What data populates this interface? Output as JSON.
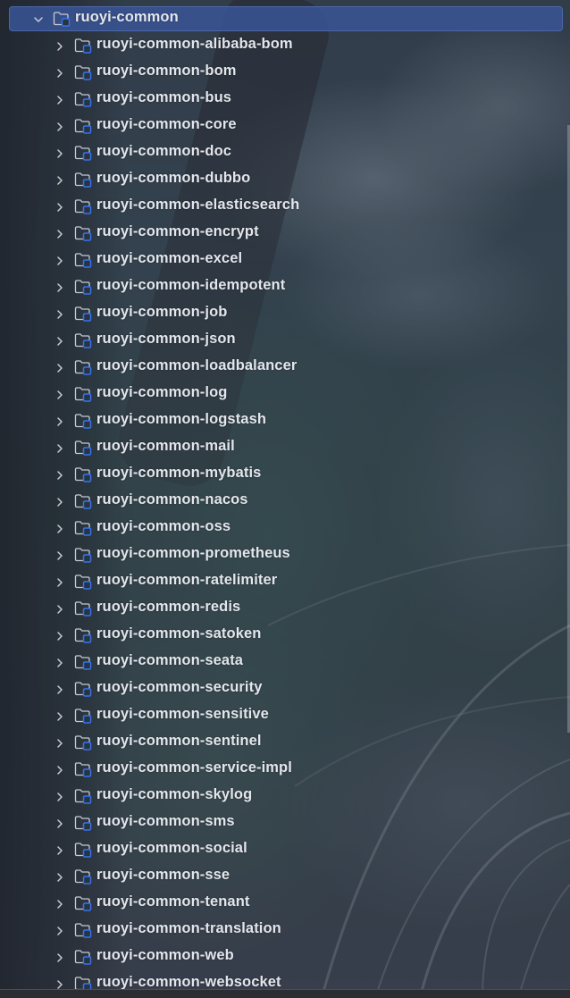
{
  "tree": {
    "root": {
      "label": "ruoyi-common",
      "expanded": true,
      "selected": true,
      "icon": "module-folder-icon"
    },
    "children": [
      {
        "label": "ruoyi-common-alibaba-bom",
        "expanded": false
      },
      {
        "label": "ruoyi-common-bom",
        "expanded": false
      },
      {
        "label": "ruoyi-common-bus",
        "expanded": false
      },
      {
        "label": "ruoyi-common-core",
        "expanded": false
      },
      {
        "label": "ruoyi-common-doc",
        "expanded": false
      },
      {
        "label": "ruoyi-common-dubbo",
        "expanded": false
      },
      {
        "label": "ruoyi-common-elasticsearch",
        "expanded": false
      },
      {
        "label": "ruoyi-common-encrypt",
        "expanded": false
      },
      {
        "label": "ruoyi-common-excel",
        "expanded": false
      },
      {
        "label": "ruoyi-common-idempotent",
        "expanded": false
      },
      {
        "label": "ruoyi-common-job",
        "expanded": false
      },
      {
        "label": "ruoyi-common-json",
        "expanded": false
      },
      {
        "label": "ruoyi-common-loadbalancer",
        "expanded": false
      },
      {
        "label": "ruoyi-common-log",
        "expanded": false
      },
      {
        "label": "ruoyi-common-logstash",
        "expanded": false
      },
      {
        "label": "ruoyi-common-mail",
        "expanded": false
      },
      {
        "label": "ruoyi-common-mybatis",
        "expanded": false
      },
      {
        "label": "ruoyi-common-nacos",
        "expanded": false
      },
      {
        "label": "ruoyi-common-oss",
        "expanded": false
      },
      {
        "label": "ruoyi-common-prometheus",
        "expanded": false
      },
      {
        "label": "ruoyi-common-ratelimiter",
        "expanded": false
      },
      {
        "label": "ruoyi-common-redis",
        "expanded": false
      },
      {
        "label": "ruoyi-common-satoken",
        "expanded": false
      },
      {
        "label": "ruoyi-common-seata",
        "expanded": false
      },
      {
        "label": "ruoyi-common-security",
        "expanded": false
      },
      {
        "label": "ruoyi-common-sensitive",
        "expanded": false
      },
      {
        "label": "ruoyi-common-sentinel",
        "expanded": false
      },
      {
        "label": "ruoyi-common-service-impl",
        "expanded": false
      },
      {
        "label": "ruoyi-common-skylog",
        "expanded": false
      },
      {
        "label": "ruoyi-common-sms",
        "expanded": false
      },
      {
        "label": "ruoyi-common-social",
        "expanded": false
      },
      {
        "label": "ruoyi-common-sse",
        "expanded": false
      },
      {
        "label": "ruoyi-common-tenant",
        "expanded": false
      },
      {
        "label": "ruoyi-common-translation",
        "expanded": false
      },
      {
        "label": "ruoyi-common-web",
        "expanded": false
      },
      {
        "label": "ruoyi-common-websocket",
        "expanded": false
      }
    ]
  },
  "colors": {
    "selection": "#3a5596",
    "text": "#e3e6ec",
    "module_badge": "#3574f0",
    "chevron": "#c9ccd3"
  }
}
